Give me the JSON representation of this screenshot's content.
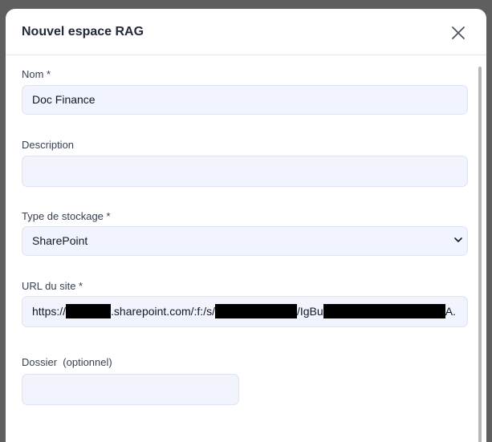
{
  "modal": {
    "title": "Nouvel espace RAG",
    "close_icon": "close-icon"
  },
  "fields": {
    "nom": {
      "label": "Nom *",
      "value": "Doc Finance"
    },
    "description": {
      "label": "Description",
      "value": ""
    },
    "type_stockage": {
      "label": "Type de stockage *",
      "selected": "SharePoint",
      "icon": "chevron-down-icon"
    },
    "url_site": {
      "label": "URL du site *",
      "part1": "https://",
      "part2": ".sharepoint.com/:f:/s/",
      "part3": "/IgBu",
      "part4": "A."
    },
    "dossier": {
      "label": "Dossier  (optionnel)",
      "value": ""
    }
  }
}
